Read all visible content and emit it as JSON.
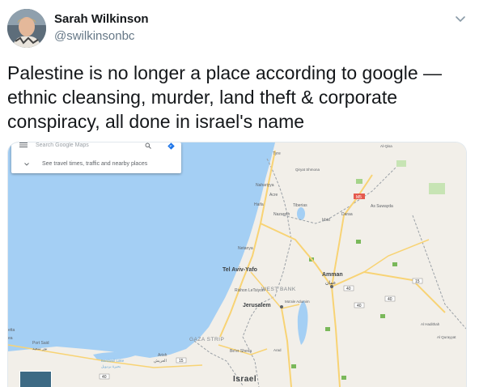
{
  "tweet": {
    "author_name": "Sarah Wilkinson",
    "author_handle": "@swilkinsonbc",
    "text": "Palestine is no longer a place according to google — ethnic cleansing, murder, land theft & corporate conspiracy, all done in israel's name"
  },
  "map": {
    "search_placeholder": "Search Google Maps",
    "suggestion": "See travel times, traffic and nearby places",
    "labels": {
      "tyre": "Tyre",
      "qiryat_shmona": "Qiryat Shmona",
      "nahariyya": "Nahariyya",
      "acre": "Acre",
      "haifa": "Haifa",
      "tiberias": "Tiberias",
      "nazareth": "Nazareth",
      "daraa": "Daraa",
      "irbid": "Irbid",
      "as_suwayda": "As Suwayda",
      "netanya": "Netanya",
      "tel_aviv": "Tel Aviv-Yafo",
      "rishon": "Rishon LeTsiyon",
      "west_bank": "WEST BANK",
      "jerusalem": "Jerusalem",
      "maale_adumim": "Ma'ale Adumim",
      "amman": "Amman",
      "amman_ar": "عمان",
      "gaza_strip": "GAZA STRIP",
      "beer_sheva": "Be'er Sheva",
      "arad": "Arad",
      "port_said": "Port Said",
      "port_said_ar": "بور سعيد",
      "bardawil": "Bardawil Lake",
      "bardawil_ar": "بحيرة بردويل",
      "arish": "Arish",
      "arish_ar": "العريش",
      "israel": "Israel",
      "al_qisa": "Al-Qisa",
      "al_haditha": "Al Hadithah",
      "al_qurayyat": "Al Qurayyat",
      "etta": "etta",
      "ea": "ea"
    },
    "road_shields": [
      "M5",
      "40",
      "15",
      "40",
      "40",
      "40",
      "15"
    ]
  },
  "colors": {
    "sea": "#a4cff4",
    "land": "#f2efe9",
    "road": "#f8d374",
    "green": "#7ab85a",
    "border": "#9aa0a6"
  }
}
